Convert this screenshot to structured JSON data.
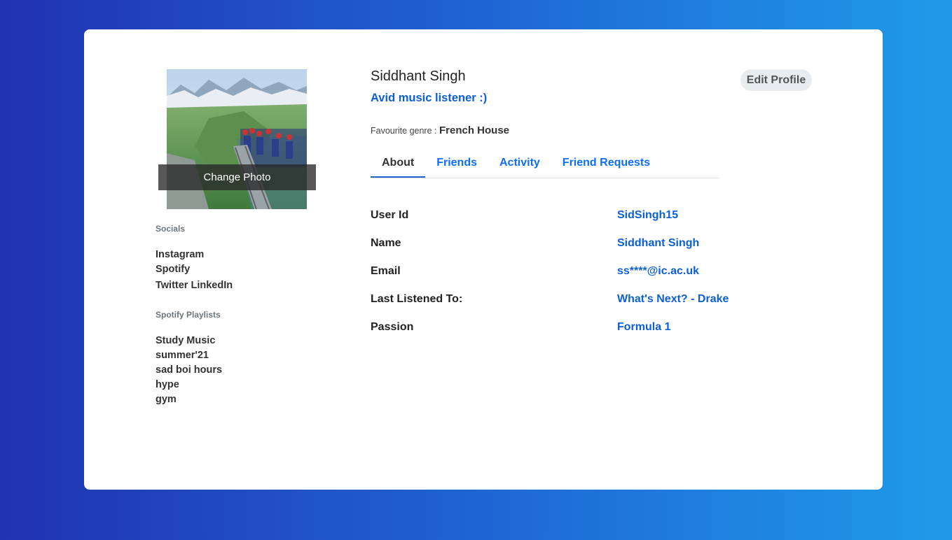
{
  "profile": {
    "change_photo_label": "Change Photo",
    "name": "Siddhant Singh",
    "bio": "Avid music listener :)",
    "genre_label": "Favourite genre :",
    "genre_value": "French House",
    "edit_label": "Edit Profile"
  },
  "socials": {
    "heading": "Socials",
    "items": [
      "Instagram",
      "Spotify",
      "Twitter",
      "LinkedIn"
    ]
  },
  "playlists": {
    "heading": "Spotify Playlists",
    "items": [
      "Study Music",
      "summer'21",
      "sad boi hours",
      "hype",
      "gym"
    ]
  },
  "tabs": [
    {
      "label": "About",
      "active": true
    },
    {
      "label": "Friends",
      "active": false
    },
    {
      "label": "Activity",
      "active": false
    },
    {
      "label": "Friend Requests",
      "active": false
    }
  ],
  "about": [
    {
      "label": "User Id",
      "value": "SidSingh15"
    },
    {
      "label": "Name",
      "value": "Siddhant Singh"
    },
    {
      "label": "Email",
      "value": "ss****@ic.ac.uk"
    },
    {
      "label": "Last Listened To:",
      "value": "What's Next? - Drake"
    },
    {
      "label": "Passion",
      "value": "Formula 1"
    }
  ],
  "colors": {
    "accent": "#0d5fd6",
    "tab_link": "#0d6efd",
    "background_start": "#2132b1",
    "background_end": "#1f9be9"
  }
}
